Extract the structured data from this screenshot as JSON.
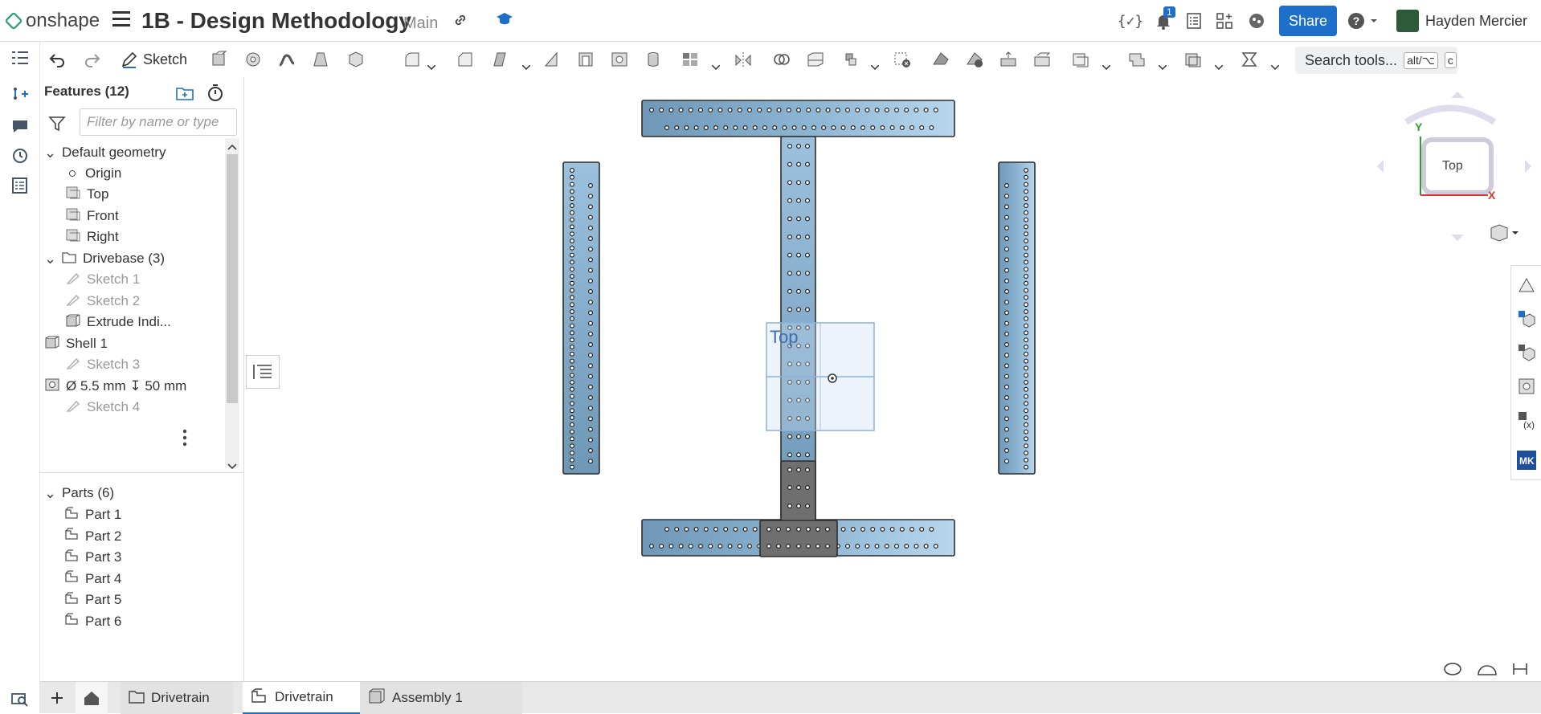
{
  "app": {
    "name": "onshape",
    "doc_title": "1B - Design Methodology",
    "branch": "Main",
    "notification_count": "1",
    "share_label": "Share",
    "user_name": "Hayden Mercier"
  },
  "toolbar": {
    "sketch_label": "Sketch",
    "search_label": "Search tools...",
    "search_kbd1": "alt/⌥",
    "search_kbd2": "c"
  },
  "features": {
    "header": "Features (12)",
    "filter_placeholder": "Filter by name or type",
    "items": [
      {
        "label": "Default geometry",
        "kind": "group"
      },
      {
        "label": "Origin",
        "kind": "origin"
      },
      {
        "label": "Top",
        "kind": "plane"
      },
      {
        "label": "Front",
        "kind": "plane"
      },
      {
        "label": "Right",
        "kind": "plane"
      },
      {
        "label": "Drivebase (3)",
        "kind": "folder"
      },
      {
        "label": "Sketch 1",
        "kind": "sketch"
      },
      {
        "label": "Sketch 2",
        "kind": "sketch"
      },
      {
        "label": "Extrude Indi...",
        "kind": "extrude"
      },
      {
        "label": "Shell 1",
        "kind": "shell"
      },
      {
        "label": "Sketch 3",
        "kind": "sketch"
      },
      {
        "label": "Ø 5.5 mm ↧ 50 mm",
        "kind": "hole"
      },
      {
        "label": "Sketch 4",
        "kind": "sketch"
      }
    ],
    "parts_header": "Parts (6)",
    "parts": [
      "Part 1",
      "Part 2",
      "Part 3",
      "Part 4",
      "Part 5",
      "Part 6"
    ]
  },
  "viewport": {
    "plane_label": "Top",
    "view_cube_label": "Top",
    "axis_x": "X",
    "axis_y": "Y"
  },
  "tabs": [
    {
      "label": "Drivetrain",
      "kind": "folder"
    },
    {
      "label": "Drivetrain",
      "kind": "partstudio",
      "active": true
    },
    {
      "label": "Assembly 1",
      "kind": "assembly"
    }
  ],
  "colors": {
    "accent": "#1d6fc9",
    "part_blue": "#7ca4c2",
    "part_gray": "#6f6f6f",
    "logo": "#2f9e7a"
  }
}
